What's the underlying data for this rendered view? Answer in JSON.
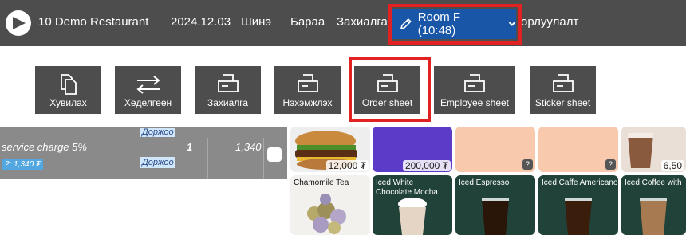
{
  "topbar": {
    "restaurant": "10 Demo Restaurant",
    "date": "2024.12.03",
    "nav_new": "Шинэ",
    "nav_goods": "Бараа",
    "nav_order": "Захиалга",
    "room_label": "Room F (10:48)",
    "nav_settings": "орлуулалт"
  },
  "toolbar": {
    "copy": "Хувилах",
    "transfer": "Хөделгөөн",
    "order": "Захиалга",
    "receipt": "Нэхэмжлэх",
    "order_sheet": "Order sheet",
    "employee_sheet": "Employee sheet",
    "sticker_sheet": "Sticker sheet"
  },
  "order_panel": {
    "top_tag": "Доржоо",
    "item": {
      "name": "service charge 5%",
      "price_tag": "?: 1,340 ₮",
      "staff": "Доржоо",
      "qty": "1",
      "amount": "1,340"
    }
  },
  "products": {
    "burger_price": "12,000 ₮",
    "purple_price": "200,000 ₮",
    "last_price": "6,50",
    "q": "?",
    "chamomile": "Chamomile Tea",
    "iced_white_mocha": "Iced White Chocolate Mocha",
    "iced_espresso": "Iced Espresso",
    "iced_americano": "Iced Caffe Americano",
    "iced_coffee_milk": "Iced Coffee with"
  },
  "colors": {
    "topbar_bg": "#4d4d4d",
    "room_button": "#1a56a8",
    "highlight": "#e02222",
    "tile_peach": "#f9c9ad",
    "tile_purple": "#5b3bc8",
    "tile_dark": "#214238"
  }
}
